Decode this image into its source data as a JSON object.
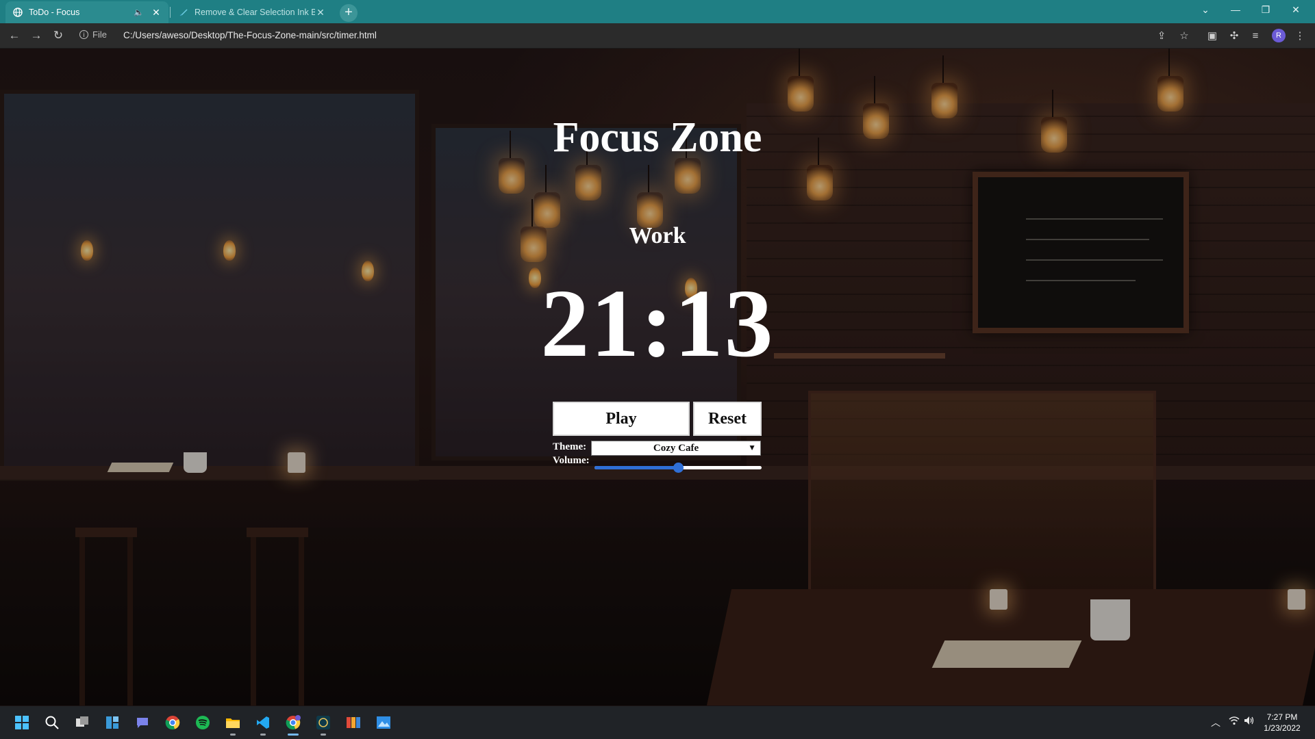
{
  "browser": {
    "tabs": [
      {
        "title": "ToDo - Focus",
        "favicon": "globe-icon",
        "audio": true,
        "active": true
      },
      {
        "title": "Remove & Clear Selection Ink Bo",
        "favicon": "feather-icon",
        "active": false
      }
    ],
    "new_tab_label": "+",
    "address": {
      "security_label": "File",
      "url": "C:/Users/aweso/Desktop/The-Focus-Zone-main/src/timer.html"
    },
    "profile_initial": "R"
  },
  "app": {
    "title": "Focus Zone",
    "mode": "Work",
    "timer": "21:13",
    "play_label": "Play",
    "reset_label": "Reset",
    "theme_label": "Theme:",
    "theme_value": "Cozy Cafe",
    "volume_label": "Volume:",
    "volume_value": 0.5
  },
  "taskbar": {
    "apps": [
      "start-icon",
      "search-icon",
      "task-view-icon",
      "widgets-icon",
      "teams-chat-icon",
      "chrome-icon",
      "spotify-icon",
      "file-explorer-icon",
      "vscode-icon",
      "chrome-profile-icon",
      "app-icon-7",
      "app-icon-8",
      "photos-icon"
    ],
    "time": "7:27 PM",
    "date": "1/23/2022"
  },
  "colors": {
    "tab_strip": "#1f7f84",
    "toolbar": "#2b2b2b",
    "slider_accent": "#2f6fd6",
    "taskbar": "#202327"
  }
}
